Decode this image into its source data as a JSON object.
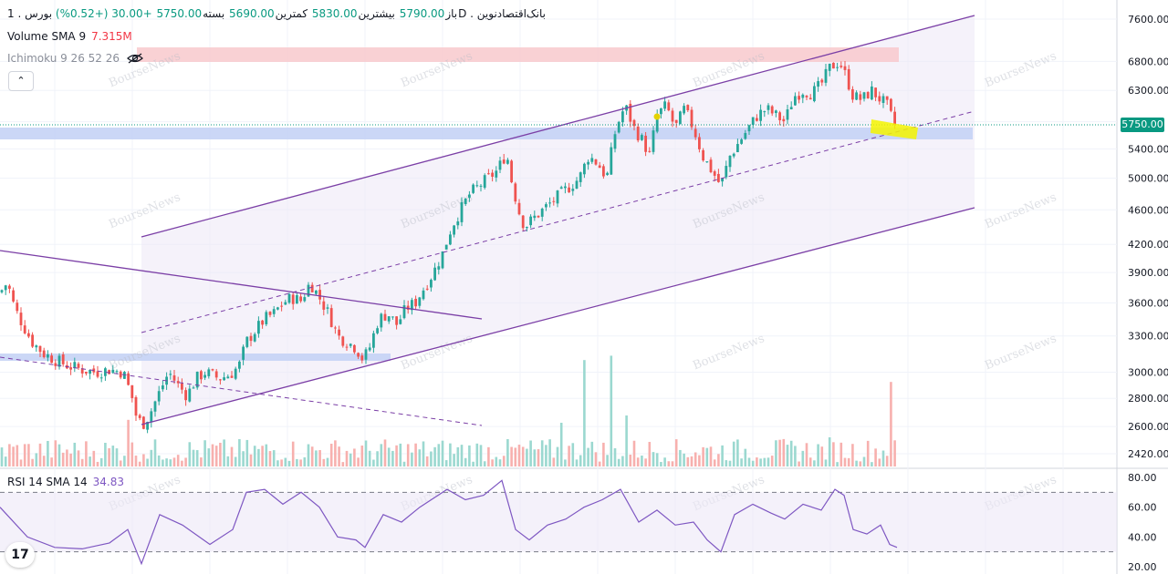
{
  "legend": {
    "symbol_line": [
      {
        "text": "باز",
        "cls": ""
      },
      {
        "text": "5790.00",
        "cls": "v-green"
      },
      {
        "text": " بیشترین",
        "cls": ""
      },
      {
        "text": "5830.00",
        "cls": "v-green"
      },
      {
        "text": " کمترین",
        "cls": ""
      },
      {
        "text": "5690.00",
        "cls": "v-green"
      },
      {
        "text": " بسته",
        "cls": ""
      },
      {
        "text": "5750.00",
        "cls": "v-green"
      },
      {
        "text": " +30.00 (+0.52%)",
        "cls": "v-green"
      },
      {
        "text": " بورس . 1D . بانک‌اقتصادنوین",
        "cls": ""
      }
    ],
    "volume_label": "Volume SMA 9",
    "volume_value": "7.315M",
    "ichimoku_label": "Ichimoku 9 26 52 26",
    "rsi_label": "RSI 14 SMA 14",
    "rsi_value": "34.83"
  },
  "watermark": "BourseNews",
  "tv_logo": "17",
  "last_price_tag": "5750.00",
  "colors": {
    "up": "#26a69a",
    "down": "#ef5350",
    "channel": "#7b3fa6",
    "rsi_line": "#7e57c2",
    "support_zone": "#c5d3f5",
    "resistance_zone": "#f8c9cc",
    "highlight": "#f5f500"
  },
  "chart_data": [
    {
      "type": "candlestick",
      "y_scale": "log",
      "ylim": [
        2300,
        7700
      ],
      "y_ticks": [
        "7600.00",
        "6800.00",
        "6300.00",
        "5800.00",
        "5400.00",
        "5000.00",
        "4600.00",
        "4200.00",
        "3900.00",
        "3600.00",
        "3300.00",
        "3000.00",
        "2800.00",
        "2600.00",
        "2420.00"
      ],
      "y_tick_values": [
        7600,
        6800,
        6300,
        5800,
        5400,
        5000,
        4600,
        4200,
        3900,
        3600,
        3300,
        3000,
        2800,
        2600,
        2420
      ],
      "last_close": 5750,
      "close_path": [
        [
          0,
          3700
        ],
        [
          8,
          3800
        ],
        [
          16,
          3550
        ],
        [
          25,
          3400
        ],
        [
          35,
          3250
        ],
        [
          48,
          3150
        ],
        [
          60,
          3100
        ],
        [
          75,
          3050
        ],
        [
          90,
          3020
        ],
        [
          105,
          3000
        ],
        [
          120,
          3020
        ],
        [
          135,
          3000
        ],
        [
          145,
          2800
        ],
        [
          150,
          2650
        ],
        [
          158,
          2620
        ],
        [
          165,
          2700
        ],
        [
          175,
          2850
        ],
        [
          185,
          3000
        ],
        [
          195,
          2900
        ],
        [
          205,
          2820
        ],
        [
          215,
          2950
        ],
        [
          225,
          3000
        ],
        [
          240,
          2950
        ],
        [
          252,
          2980
        ],
        [
          262,
          3050
        ],
        [
          270,
          3250
        ],
        [
          280,
          3350
        ],
        [
          290,
          3450
        ],
        [
          300,
          3500
        ],
        [
          310,
          3600
        ],
        [
          320,
          3650
        ],
        [
          330,
          3620
        ],
        [
          340,
          3800
        ],
        [
          350,
          3650
        ],
        [
          360,
          3500
        ],
        [
          370,
          3300
        ],
        [
          380,
          3250
        ],
        [
          390,
          3200
        ],
        [
          398,
          3100
        ],
        [
          405,
          3200
        ],
        [
          415,
          3450
        ],
        [
          425,
          3500
        ],
        [
          435,
          3400
        ],
        [
          445,
          3550
        ],
        [
          455,
          3600
        ],
        [
          465,
          3750
        ],
        [
          475,
          3900
        ],
        [
          485,
          4100
        ],
        [
          495,
          4400
        ],
        [
          505,
          4600
        ],
        [
          515,
          4800
        ],
        [
          525,
          4900
        ],
        [
          535,
          5000
        ],
        [
          545,
          5100
        ],
        [
          555,
          5350
        ],
        [
          560,
          5000
        ],
        [
          568,
          4600
        ],
        [
          575,
          4400
        ],
        [
          585,
          4500
        ],
        [
          595,
          4600
        ],
        [
          605,
          4700
        ],
        [
          615,
          4800
        ],
        [
          625,
          4900
        ],
        [
          635,
          5000
        ],
        [
          645,
          5300
        ],
        [
          655,
          5200
        ],
        [
          665,
          5000
        ],
        [
          675,
          5700
        ],
        [
          685,
          6050
        ],
        [
          695,
          5700
        ],
        [
          705,
          5500
        ],
        [
          712,
          5300
        ],
        [
          720,
          5900
        ],
        [
          730,
          6050
        ],
        [
          740,
          5700
        ],
        [
          750,
          6000
        ],
        [
          760,
          5700
        ],
        [
          770,
          5300
        ],
        [
          780,
          5100
        ],
        [
          790,
          4900
        ],
        [
          800,
          5300
        ],
        [
          810,
          5500
        ],
        [
          820,
          5700
        ],
        [
          830,
          5900
        ],
        [
          840,
          6000
        ],
        [
          850,
          5900
        ],
        [
          860,
          5800
        ],
        [
          870,
          6200
        ],
        [
          880,
          6300
        ],
        [
          890,
          6250
        ],
        [
          900,
          6400
        ],
        [
          910,
          6700
        ],
        [
          920,
          6800
        ],
        [
          928,
          6500
        ],
        [
          935,
          6200
        ],
        [
          945,
          6150
        ],
        [
          955,
          6300
        ],
        [
          965,
          6150
        ],
        [
          972,
          6050
        ],
        [
          980,
          5750
        ]
      ],
      "volume_spikes": [
        [
          141,
          3.2
        ],
        [
          615,
          3.0
        ],
        [
          640,
          7.3
        ],
        [
          670,
          7.6
        ],
        [
          685,
          3.5
        ],
        [
          910,
          2.0
        ],
        [
          975,
          5.8
        ]
      ],
      "rsi": {
        "ylim": [
          20,
          80
        ],
        "y_ticks": [
          "80.00",
          "60.00",
          "40.00",
          "20.00"
        ],
        "y_tick_values": [
          80,
          60,
          40,
          20
        ],
        "bands": [
          70,
          30
        ],
        "series": [
          [
            0,
            60
          ],
          [
            30,
            40
          ],
          [
            60,
            33
          ],
          [
            90,
            32
          ],
          [
            120,
            36
          ],
          [
            140,
            45
          ],
          [
            155,
            22
          ],
          [
            175,
            55
          ],
          [
            200,
            48
          ],
          [
            230,
            35
          ],
          [
            255,
            45
          ],
          [
            270,
            70
          ],
          [
            290,
            72
          ],
          [
            310,
            62
          ],
          [
            330,
            70
          ],
          [
            350,
            60
          ],
          [
            370,
            40
          ],
          [
            390,
            38
          ],
          [
            400,
            33
          ],
          [
            420,
            55
          ],
          [
            440,
            50
          ],
          [
            460,
            60
          ],
          [
            490,
            72
          ],
          [
            510,
            65
          ],
          [
            530,
            68
          ],
          [
            550,
            78
          ],
          [
            565,
            45
          ],
          [
            580,
            38
          ],
          [
            600,
            48
          ],
          [
            620,
            52
          ],
          [
            640,
            60
          ],
          [
            660,
            65
          ],
          [
            680,
            72
          ],
          [
            700,
            50
          ],
          [
            720,
            58
          ],
          [
            740,
            48
          ],
          [
            760,
            50
          ],
          [
            775,
            38
          ],
          [
            790,
            30
          ],
          [
            805,
            55
          ],
          [
            825,
            62
          ],
          [
            845,
            56
          ],
          [
            860,
            52
          ],
          [
            880,
            62
          ],
          [
            900,
            58
          ],
          [
            915,
            72
          ],
          [
            925,
            68
          ],
          [
            935,
            45
          ],
          [
            950,
            42
          ],
          [
            965,
            48
          ],
          [
            975,
            35
          ],
          [
            983,
            33
          ]
        ]
      }
    }
  ]
}
